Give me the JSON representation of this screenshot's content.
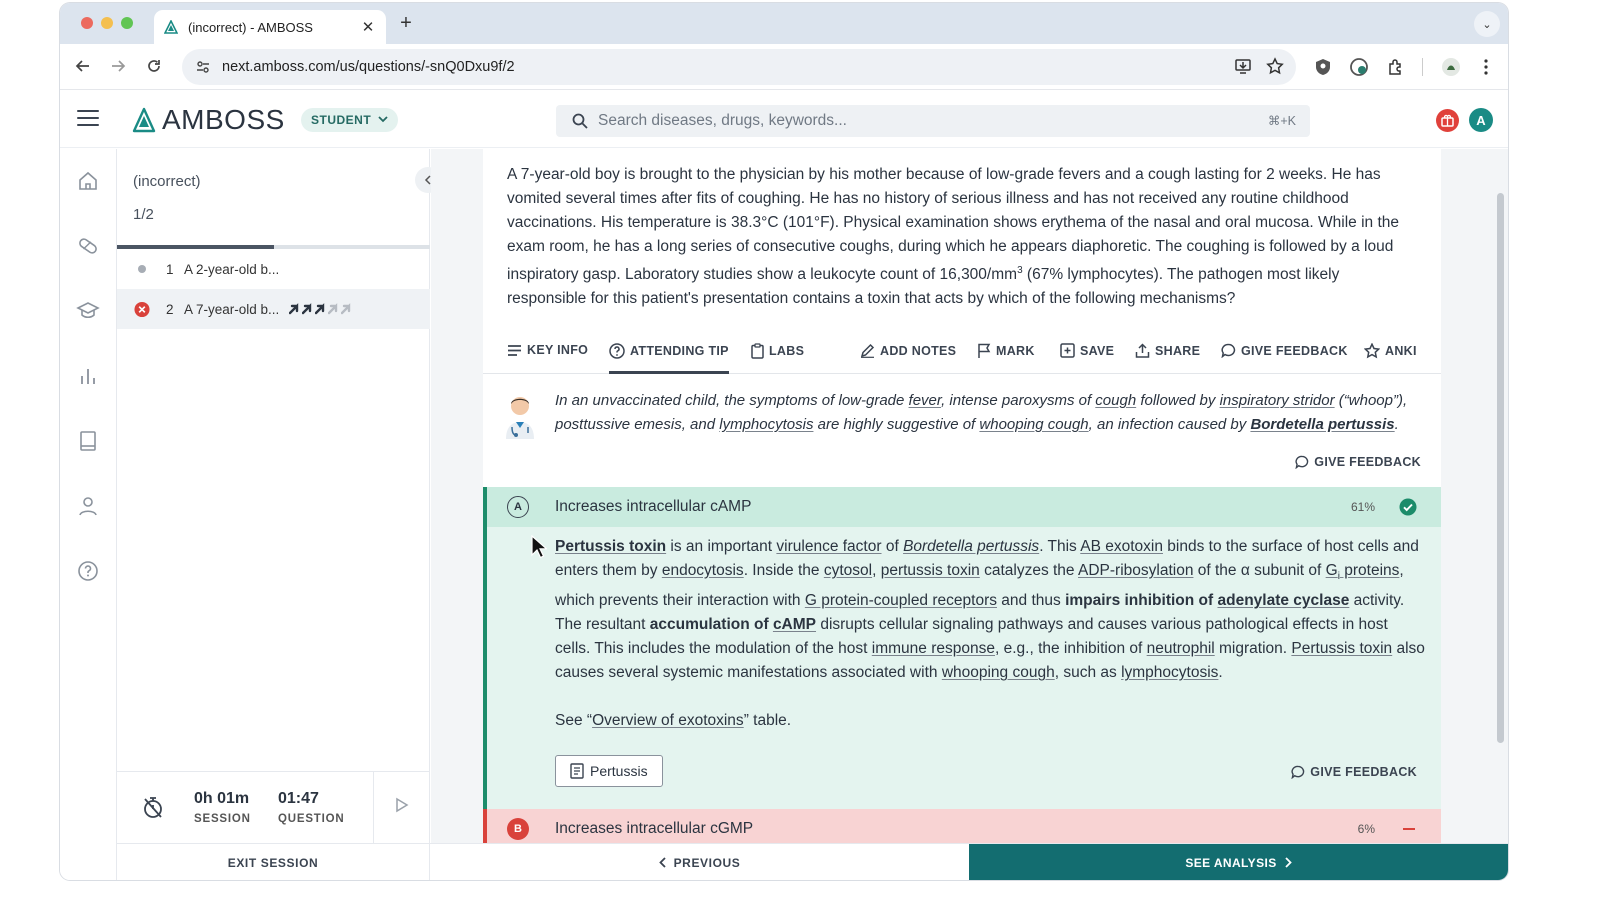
{
  "browser": {
    "tab_title": "(incorrect) - AMBOSS",
    "url": "next.amboss.com/us/questions/-snQ0Dxu9f/2"
  },
  "header": {
    "logo_text": "AMBOSS",
    "role_label": "STUDENT",
    "search_placeholder": "Search diseases, drugs, keywords...",
    "search_shortcut": "⌘+K",
    "avatar_initial": "A"
  },
  "session": {
    "title": "(incorrect)",
    "progress": "1/2",
    "progress_fraction": 0.5,
    "questions": [
      {
        "number": "1",
        "label": "A 2-year-old b...",
        "status": "unanswered"
      },
      {
        "number": "2",
        "label": "A 7-year-old b...",
        "status": "incorrect",
        "difficulty": 3,
        "difficulty_max": 5
      }
    ],
    "timer": {
      "session_value": "0h 01m",
      "session_label": "SESSION",
      "question_value": "01:47",
      "question_label": "QUESTION"
    }
  },
  "question": {
    "stem_parts": [
      "A 7-year-old boy is brought to the physician by his mother because of low-grade fevers and a cough lasting for 2 weeks. He has vomited several times after fits of coughing. He has no history of serious illness and has not received any routine childhood vaccinations. His temperature is 38.3°C (101°F). Physical examination shows erythema of the nasal and oral mucosa. While in the exam room, he has a long series of consecutive coughs, during which he appears diaphoretic. The coughing is followed by a loud inspiratory gasp. Laboratory studies show a leukocyte count of 16,300/mm",
      "3",
      " (67% lymphocytes). The pathogen most likely responsible for this patient's presentation contains a toxin that acts by which of the following mechanisms?"
    ]
  },
  "tools": {
    "key_info": "KEY INFO",
    "attending_tip": "ATTENDING TIP",
    "labs": "LABS",
    "add_notes": "ADD NOTES",
    "mark": "MARK",
    "save": "SAVE",
    "share": "SHARE",
    "give_feedback": "GIVE FEEDBACK",
    "anki": "ANKI"
  },
  "tip": {
    "t1": "In an unvaccinated child, the symptoms of low-grade ",
    "t2": "fever",
    "t3": ", intense paroxysms of ",
    "t4": "cough",
    "t5": " followed by ",
    "t6": "inspiratory stridor",
    "t7": " (“whoop”), posttussive emesis, and ",
    "t8": "lymphocytosis",
    "t9": " are highly suggestive of ",
    "t10": "whooping cough",
    "t11": ", an infection caused by ",
    "t12": "Bordetella pertussis",
    "t13": ".",
    "feedback_label": "GIVE FEEDBACK"
  },
  "answers": {
    "a": {
      "letter": "A",
      "text": "Increases intracellular cAMP",
      "percent": "61%",
      "explanation": {
        "e1": "Pertussis toxin",
        "e2": " is an important ",
        "e3": "virulence factor",
        "e4": " of ",
        "e5": "Bordetella pertussis",
        "e6": ". This ",
        "e7": "AB exotoxin",
        "e8": " binds to the surface of host cells and enters them by ",
        "e9": "endocytosis",
        "e10": ". Inside the ",
        "e11": "cytosol",
        "e12": ", ",
        "e13": "pertussis toxin",
        "e14": " catalyzes the ",
        "e15": "ADP-ribosylation",
        "e16": " of the α subunit of ",
        "e17": "G",
        "e17s": "i",
        "e18": " proteins",
        "e19": ", which prevents their interaction with ",
        "e20": "G protein-coupled receptors",
        "e21": " and thus ",
        "e22": "impairs inhibition of ",
        "e23": "adenylate cyclase",
        "e24": " activity. The resultant ",
        "e25": "accumulation of ",
        "e26": "cAMP",
        "e27": " disrupts cellular signaling pathways and causes various pathological effects in host cells. This includes the modulation of the host ",
        "e28": "immune response",
        "e29": ", e.g., the inhibition of ",
        "e30": "neutrophil",
        "e31": " migration. ",
        "e32": "Pertussis toxin",
        "e33": " also causes several systemic manifestations associated with ",
        "e34": "whooping cough",
        "e35": ", such as ",
        "e36": "lymphocytosis",
        "e37": ".",
        "see1": "See “",
        "see2": "Overview of exotoxins",
        "see3": "” table."
      },
      "article_button": "Pertussis",
      "feedback_label": "GIVE FEEDBACK"
    },
    "b": {
      "letter": "B",
      "text": "Increases intracellular cGMP",
      "percent": "6%"
    }
  },
  "footer": {
    "exit": "EXIT SESSION",
    "previous": "PREVIOUS",
    "see_analysis": "SEE ANALYSIS"
  },
  "colors": {
    "brand_teal": "#136d70",
    "correct_green": "#1c8c6a",
    "incorrect_red": "#d9423b"
  }
}
